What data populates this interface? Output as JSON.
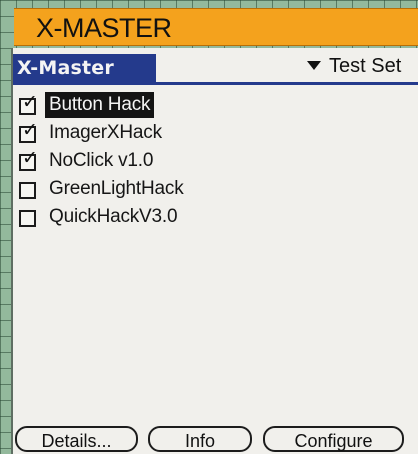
{
  "banner": {
    "title": "X-MASTER"
  },
  "app": {
    "title": "X-Master",
    "category": "Test Set"
  },
  "hacks": [
    {
      "name": "Button Hack",
      "checked": true,
      "selected": true
    },
    {
      "name": "ImagerXHack",
      "checked": true,
      "selected": false
    },
    {
      "name": "NoClick v1.0",
      "checked": true,
      "selected": false
    },
    {
      "name": "GreenLightHack",
      "checked": false,
      "selected": false
    },
    {
      "name": "QuickHackV3.0",
      "checked": false,
      "selected": false
    }
  ],
  "buttons": {
    "details": "Details...",
    "info": "Info",
    "configure": "Configure"
  },
  "icons": {
    "category_trigger": "triangle-down-icon",
    "checkbox_checked": "checkmark-icon"
  }
}
